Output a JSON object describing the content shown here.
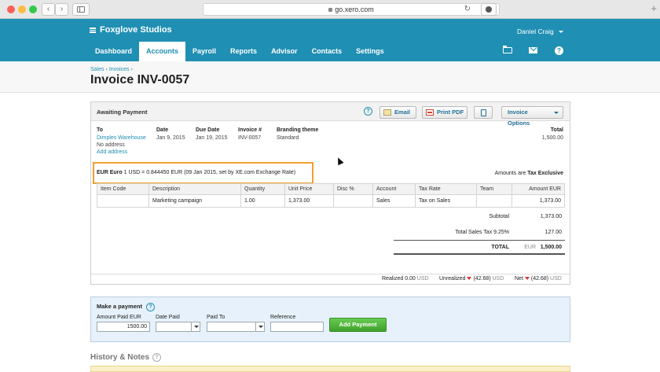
{
  "browser": {
    "url": "go.xero.com",
    "back_icon": "‹",
    "forward_icon": "›",
    "reload_icon": "↻",
    "plus_icon": "+"
  },
  "header": {
    "org_name": "Foxglove Studios",
    "user_name": "Daniel Craig",
    "tabs": [
      {
        "label": "Dashboard"
      },
      {
        "label": "Accounts",
        "active": true
      },
      {
        "label": "Payroll"
      },
      {
        "label": "Reports"
      },
      {
        "label": "Advisor"
      },
      {
        "label": "Contacts"
      },
      {
        "label": "Settings"
      }
    ],
    "help_glyph": "?",
    "brand_color": "#1f8fb3"
  },
  "breadcrumb": {
    "items": [
      "Sales",
      "Invoices"
    ],
    "sep": "›"
  },
  "page_title": "Invoice INV-0057",
  "invoice": {
    "status": "Awaiting Payment",
    "help_glyph": "?",
    "buttons": {
      "email": "Email",
      "print_pdf": "Print PDF",
      "options": "Invoice Options"
    },
    "fields": {
      "to_label": "To",
      "to_name": "Dimples Warehouse",
      "to_address": "No address",
      "add_address": "Add address",
      "date_label": "Date",
      "date": "Jan 9, 2015",
      "due_label": "Due Date",
      "due_date": "Jan 19, 2015",
      "number_label": "Invoice #",
      "number": "INV-0057",
      "theme_label": "Branding theme",
      "theme": "Standard",
      "total_label": "Total",
      "total": "1,500.00"
    },
    "fx": {
      "currency": "EUR Euro",
      "rate_text": "1 USD = 0.844450 EUR (09 Jan 2015, set by XE.com Exchange Rate)"
    },
    "amounts_are_prefix": "Amounts are",
    "amounts_are_value": "Tax Exclusive",
    "columns": [
      "Item Code",
      "Description",
      "Quantity",
      "Unit Price",
      "Disc %",
      "Account",
      "Tax Rate",
      "Team",
      "Amount EUR"
    ],
    "lines": [
      {
        "item_code": "",
        "description": "Marketing campaign",
        "quantity": "1.00",
        "unit_price": "1,373.00",
        "disc": "",
        "account": "Sales",
        "tax_rate": "Tax on Sales",
        "team": "",
        "amount": "1,373.00"
      }
    ],
    "subtotal_label": "Subtotal",
    "subtotal": "1,373.00",
    "tax_label": "Total Sales Tax 9.25%",
    "tax": "127.00",
    "total_label": "TOTAL",
    "total_currency": "EUR",
    "total": "1,500.00",
    "footer": {
      "realized_label": "Realized",
      "realized": "0.00",
      "realized_cur": "USD",
      "unrealized_label": "Unrealized",
      "unrealized": "(42.68)",
      "unrealized_cur": "USD",
      "net_label": "Net",
      "net": "(42.68)",
      "net_cur": "USD"
    }
  },
  "payment": {
    "title": "Make a payment",
    "help_glyph": "?",
    "amount_label": "Amount Paid EUR",
    "amount_value": "1500.00",
    "date_label": "Date Paid",
    "date_value": "",
    "paid_to_label": "Paid To",
    "paid_to_value": "",
    "reference_label": "Reference",
    "reference_value": "",
    "add_button": "Add Payment"
  },
  "history": {
    "title": "History & Notes",
    "help_glyph": "?"
  }
}
